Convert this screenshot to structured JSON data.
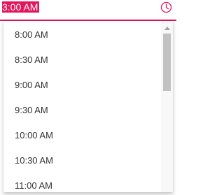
{
  "time_field": {
    "value": "3:00 AM",
    "accent_color": "#e3165b",
    "icon": "clock-icon"
  },
  "time_list": {
    "items": [
      {
        "label": "8:00 AM"
      },
      {
        "label": "8:30 AM"
      },
      {
        "label": "9:00 AM"
      },
      {
        "label": "9:30 AM"
      },
      {
        "label": "10:00 AM"
      },
      {
        "label": "10:30 AM"
      },
      {
        "label": "11:00 AM"
      }
    ]
  },
  "scrollbar": {
    "position": 0.0
  }
}
